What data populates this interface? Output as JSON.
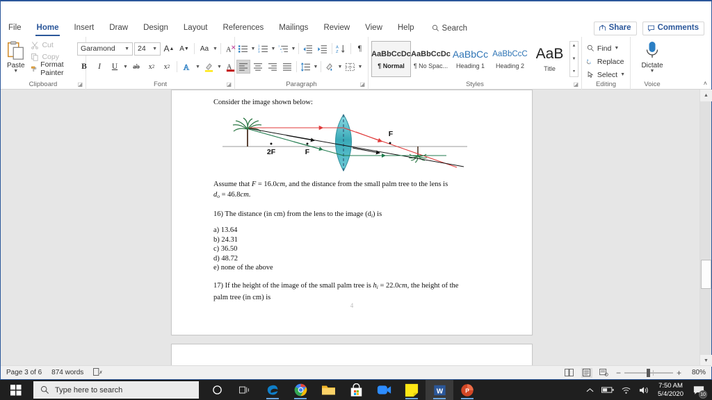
{
  "window": {
    "title": ""
  },
  "tabs": [
    {
      "label": "File",
      "active": false
    },
    {
      "label": "Home",
      "active": true
    },
    {
      "label": "Insert",
      "active": false
    },
    {
      "label": "Draw",
      "active": false
    },
    {
      "label": "Design",
      "active": false
    },
    {
      "label": "Layout",
      "active": false
    },
    {
      "label": "References",
      "active": false
    },
    {
      "label": "Mailings",
      "active": false
    },
    {
      "label": "Review",
      "active": false
    },
    {
      "label": "View",
      "active": false
    },
    {
      "label": "Help",
      "active": false
    }
  ],
  "search": {
    "label": "Search"
  },
  "titlebar_actions": {
    "share": "Share",
    "comments": "Comments"
  },
  "ribbon": {
    "clipboard": {
      "group_label": "Clipboard",
      "paste": "Paste",
      "cut": "Cut",
      "copy": "Copy",
      "format_painter": "Format Painter"
    },
    "font": {
      "group_label": "Font",
      "font_family": "Garamond",
      "font_size": "24",
      "grow_font": "A",
      "shrink_font": "A",
      "change_case": "Aa",
      "clear_formatting": "A",
      "bold": "B",
      "italic": "I",
      "underline": "U",
      "strikethrough": "ab",
      "subscript": "x",
      "superscript": "x",
      "text_effects": "A",
      "highlight": "A",
      "font_color": "A"
    },
    "paragraph": {
      "group_label": "Paragraph"
    },
    "styles": {
      "group_label": "Styles",
      "items": [
        {
          "sample": "AaBbCcDc",
          "name": "¶ Normal",
          "selected": true
        },
        {
          "sample": "AaBbCcDc",
          "name": "¶ No Spac...",
          "selected": false
        },
        {
          "sample": "AaBbCc",
          "name": "Heading 1",
          "selected": false
        },
        {
          "sample": "AaBbCcC",
          "name": "Heading 2",
          "selected": false
        },
        {
          "sample": "AaB",
          "name": "Title",
          "selected": false
        }
      ]
    },
    "editing": {
      "group_label": "Editing",
      "find": "Find",
      "replace": "Replace",
      "select": "Select"
    },
    "voice": {
      "group_label": "Voice",
      "dictate": "Dictate"
    }
  },
  "document": {
    "intro": "Consider the image shown below:",
    "assume_line1_a": "Assume that ",
    "assume_F": "F",
    "assume_line1_b": " = 16.0",
    "assume_cm1": "cm",
    "assume_line1_c": ", and the distance from the small palm tree to the lens is",
    "assume_d": "d",
    "assume_d_sub": "o",
    "assume_line2_b": " = 46.8",
    "assume_cm2": "cm",
    "assume_period": ".",
    "q16": "16) The distance (in cm) from the lens to the image (d",
    "q16_sub": "i",
    "q16_end": ") is",
    "options": [
      "a) 13.64",
      "b) 24.31",
      "c) 36.50",
      "d) 48.72",
      "e) none of the above"
    ],
    "q17_a": "17) If the height of the image of the small palm tree is ",
    "q17_h": "h",
    "q17_h_sub": "i",
    "q17_b": " = 22.0",
    "q17_cm": "cm",
    "q17_c": ", the height of the",
    "q17_d": "palm tree (in cm) is",
    "page_number": "4",
    "figure": {
      "label_2F": "2F",
      "label_F_left": "F",
      "label_F_right": "F",
      "lens_color_top": "#7fd4de",
      "lens_color_bottom": "#2e9fae",
      "ray_red": "#e03a3a",
      "ray_green": "#1f7a4d",
      "ray_black": "#111111",
      "axis_color": "#9a9a9a"
    }
  },
  "statusbar": {
    "page": "Page 3 of 6",
    "words": "874 words",
    "proofing_icon": "proofing-errors-icon",
    "zoom": "80%"
  },
  "taskbar": {
    "search_placeholder": "Type here to search",
    "apps": [
      {
        "name": "edge",
        "active": false,
        "running": true
      },
      {
        "name": "chrome",
        "active": false,
        "running": true
      },
      {
        "name": "file-explorer",
        "active": false,
        "running": false
      },
      {
        "name": "microsoft-store",
        "active": false,
        "running": false
      },
      {
        "name": "zoom",
        "active": false,
        "running": false
      },
      {
        "name": "sticky-notes",
        "active": false,
        "running": true
      },
      {
        "name": "word",
        "active": true,
        "running": true
      },
      {
        "name": "powerpoint",
        "active": false,
        "running": true
      }
    ],
    "time": "7:50 AM",
    "date": "5/4/2020",
    "notification_count": "10"
  }
}
